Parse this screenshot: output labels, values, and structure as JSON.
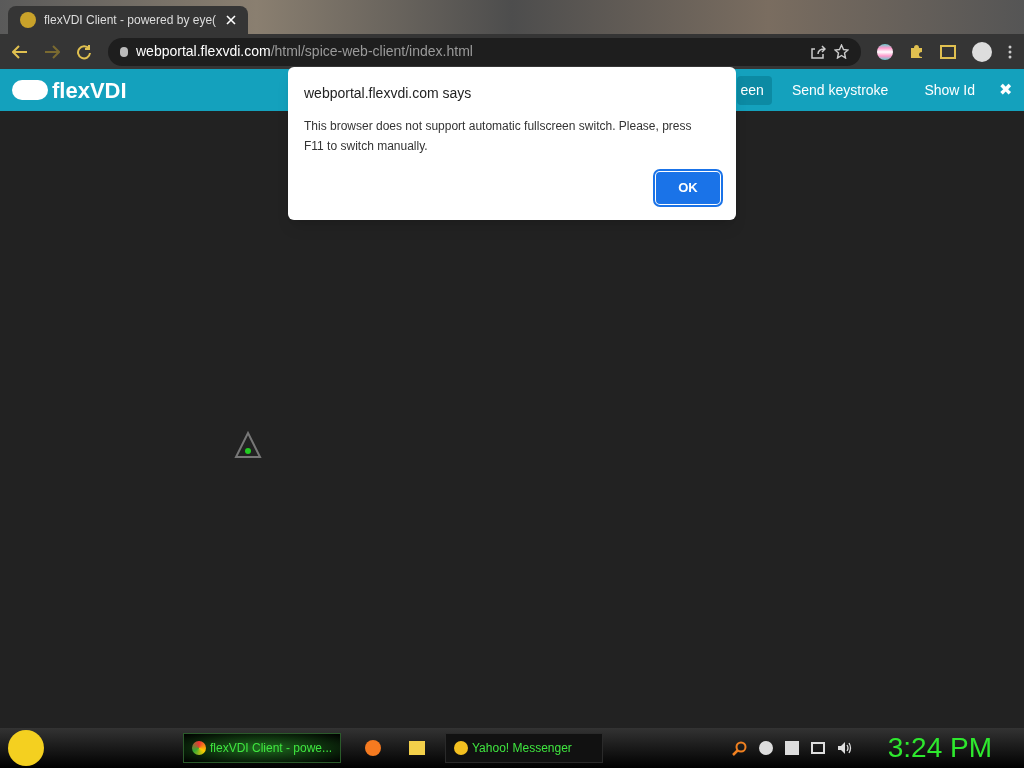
{
  "browser_tab": {
    "title": "flexVDI Client - powered by eye(",
    "selected": true
  },
  "address_bar": {
    "host": "webportal.flexvdi.com",
    "path": "/html/spice-web-client/index.html"
  },
  "app_bar": {
    "logo": "flexVDI",
    "buttons": [
      {
        "label": "een",
        "selected": true
      },
      {
        "label": "Send keystroke",
        "selected": false
      },
      {
        "label": "Show Id",
        "selected": false
      }
    ],
    "close": "✖"
  },
  "dialog": {
    "title": "webportal.flexvdi.com says",
    "message": "This browser does not support automatic fullscreen switch. Please, press F11 to switch manually.",
    "button": "OK"
  },
  "taskbar": {
    "windows": [
      {
        "label": "flexVDI Client - powe...",
        "selected": true
      },
      {
        "label": "Yahoo! Messenger",
        "selected": false
      }
    ],
    "clock": "3:24 PM"
  }
}
